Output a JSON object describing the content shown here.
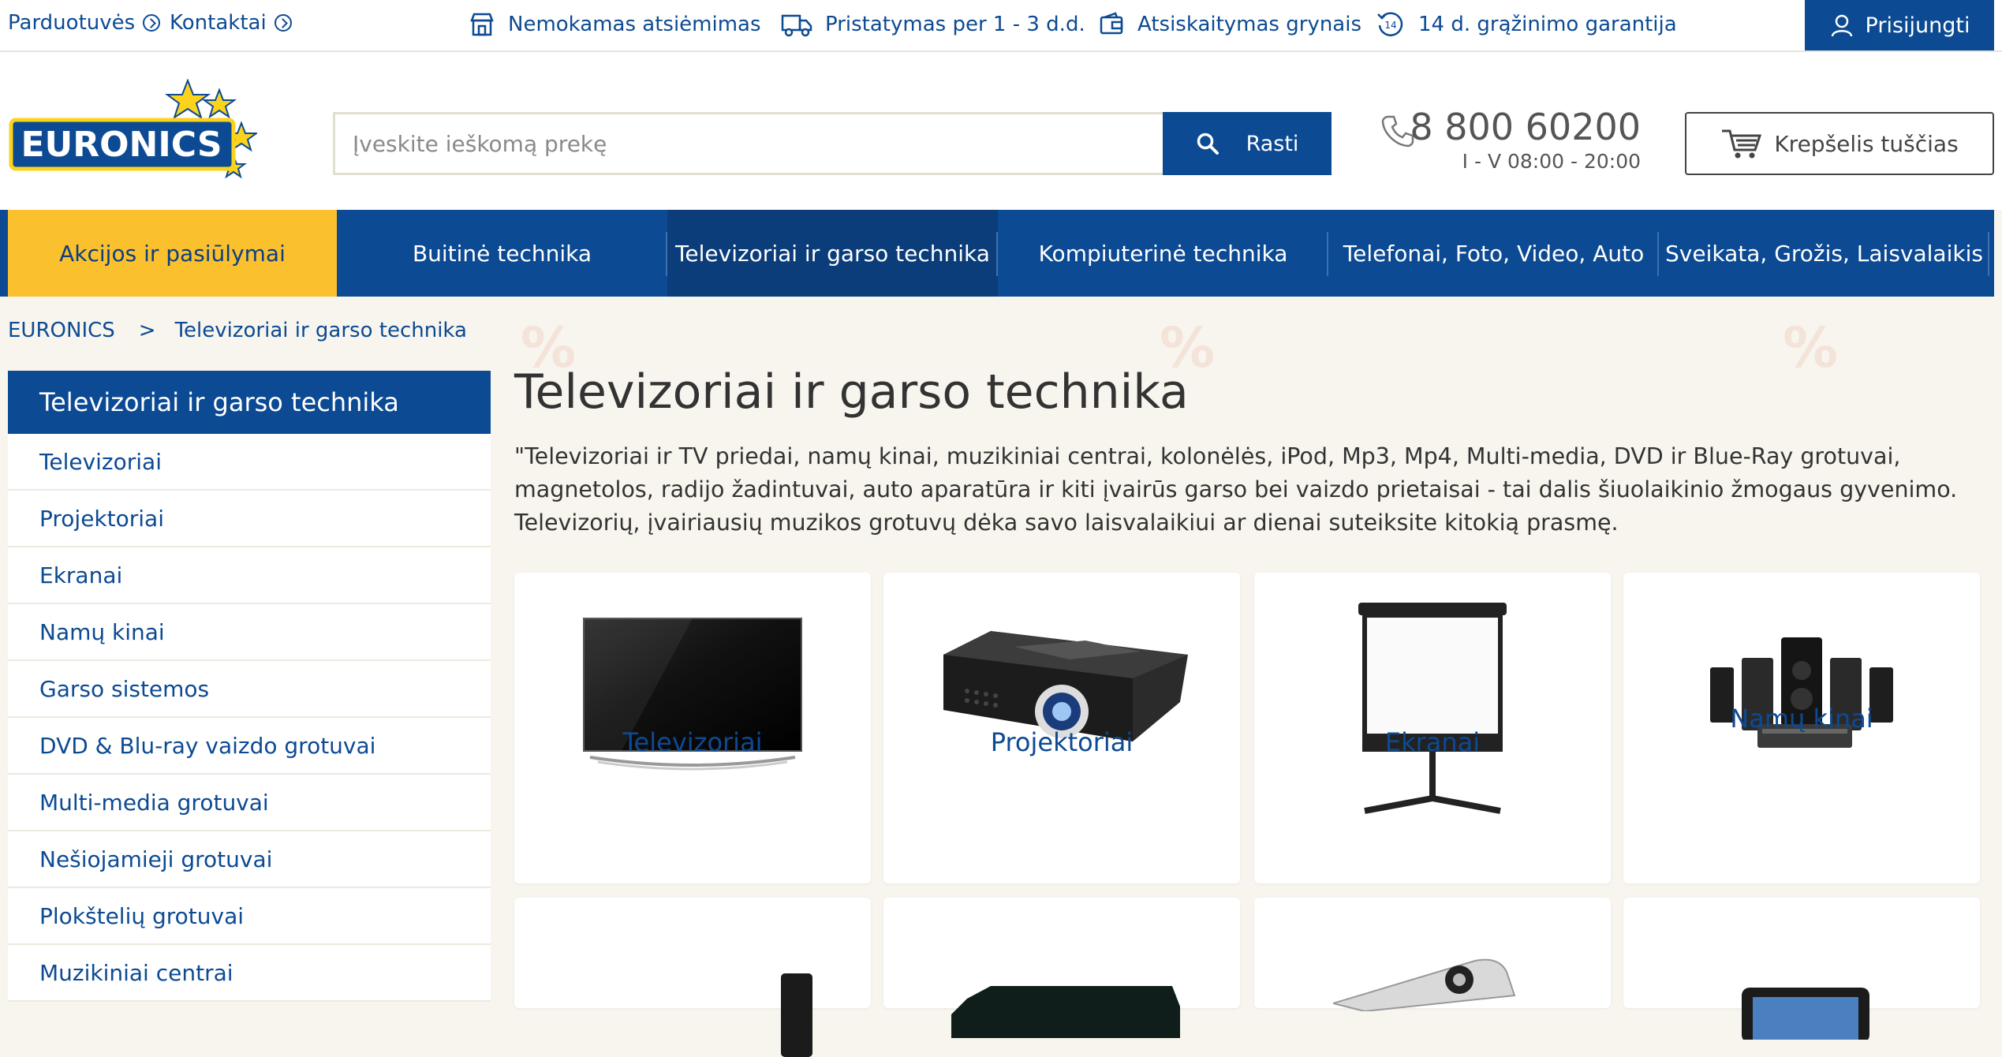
{
  "topbar": {
    "links": [
      {
        "label": "Parduotuvės"
      },
      {
        "label": "Kontaktai"
      }
    ],
    "benefits": [
      {
        "label": "Nemokamas atsiėmimas",
        "icon": "store-icon"
      },
      {
        "label": "Pristatymas per 1 - 3 d.d.",
        "icon": "truck-icon"
      },
      {
        "label": "Atsiskaitymas grynais",
        "icon": "wallet-icon"
      },
      {
        "label": "14 d. grąžinimo garantija",
        "icon": "return-14-icon",
        "icon_text": "14"
      }
    ],
    "login_label": "Prisijungti"
  },
  "header": {
    "logo_text": "EURONICS",
    "search": {
      "placeholder": "Įveskite ieškomą prekę",
      "button_label": "Rasti"
    },
    "phone": {
      "number": "8 800 60200",
      "hours": "I - V 08:00 - 20:00"
    },
    "cart_label": "Krepšelis tuščias"
  },
  "nav": {
    "items": [
      {
        "label": "Akcijos ir pasiūlymai"
      },
      {
        "label": "Buitinė technika"
      },
      {
        "label": "Televizoriai ir garso technika"
      },
      {
        "label": "Kompiuterinė technika"
      },
      {
        "label": "Telefonai, Foto, Video, Auto"
      },
      {
        "label": "Sveikata, Grožis, Laisvalaikis"
      }
    ],
    "active_index": 2
  },
  "breadcrumb": {
    "items": [
      {
        "label": "EURONICS"
      },
      {
        "label": "Televizoriai ir garso technika"
      }
    ],
    "separator": ">"
  },
  "sidebar": {
    "heading": "Televizoriai ir garso technika",
    "items": [
      {
        "label": "Televizoriai"
      },
      {
        "label": "Projektoriai"
      },
      {
        "label": "Ekranai"
      },
      {
        "label": "Namų kinai"
      },
      {
        "label": "Garso sistemos"
      },
      {
        "label": "DVD & Blu-ray vaizdo grotuvai"
      },
      {
        "label": "Multi-media grotuvai"
      },
      {
        "label": "Nešiojamieji grotuvai"
      },
      {
        "label": "Plokštelių grotuvai"
      },
      {
        "label": "Muzikiniai centrai"
      }
    ]
  },
  "main": {
    "title": "Televizoriai ir garso technika",
    "intro": "\"Televizoriai ir TV priedai, namų kinai, muzikiniai centrai, kolonėlės, iPod, Mp3, Mp4, Multi-media, DVD ir Blue-Ray grotuvai, magnetolos, radijo žadintuvai, auto aparatūra ir kiti įvairūs garso bei vaizdo prietaisai - tai dalis šiuolaikinio žmogaus gyvenimo. Televizorių, įvairiausių muzikos grotuvų dėka savo laisvalaikiui ar dienai suteiksite kitokią prasmę.",
    "categories": [
      {
        "label": "Televizoriai"
      },
      {
        "label": "Projektoriai"
      },
      {
        "label": "Ekranai"
      },
      {
        "label": "Namų kinai"
      }
    ],
    "watermark_symbol": "%"
  },
  "colors": {
    "brand_blue": "#0c4a93",
    "active_nav": "#0a3d7a",
    "promo_yellow": "#fbc02d",
    "page_bg": "#f7f5ee"
  }
}
